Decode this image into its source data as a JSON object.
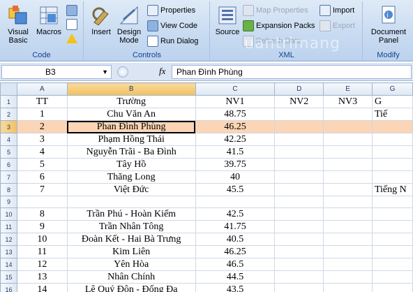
{
  "ribbon": {
    "groups": {
      "code": {
        "label": "Code",
        "visual_basic": "Visual\nBasic",
        "macros": "Macros"
      },
      "controls": {
        "label": "Controls",
        "insert": "Insert",
        "design_mode": "Design\nMode",
        "properties": "Properties",
        "view_code": "View Code",
        "run_dialog": "Run Dialog"
      },
      "xml": {
        "label": "XML",
        "source": "Source",
        "map_properties": "Map Properties",
        "expansion_packs": "Expansion Packs",
        "refresh_data": "Refresh Data",
        "import": "Import",
        "export": "Export"
      },
      "modify": {
        "label": "Modify",
        "document_panel": "Document\nPanel"
      }
    },
    "watermark": "uantrimang"
  },
  "formula_bar": {
    "name_box": "B3",
    "fx": "fx",
    "formula": "Phan Đình Phùng"
  },
  "grid": {
    "columns": [
      "A",
      "B",
      "C",
      "D",
      "E",
      "G"
    ],
    "selected_col": "B",
    "rows": [
      {
        "n": "1",
        "a": "TT",
        "b": "Trường",
        "c": "NV1",
        "d": "NV2",
        "e": "NV3",
        "g": "G"
      },
      {
        "n": "2",
        "a": "1",
        "b": "Chu Văn An",
        "c": "48.75",
        "d": "",
        "e": "",
        "g": "Tiế"
      },
      {
        "n": "3",
        "a": "2",
        "b": "Phan Đình Phùng",
        "c": "46.25",
        "d": "",
        "e": "",
        "g": ""
      },
      {
        "n": "4",
        "a": "3",
        "b": "Phạm Hồng Thái",
        "c": "42.25",
        "d": "",
        "e": "",
        "g": ""
      },
      {
        "n": "5",
        "a": "4",
        "b": "Nguyễn Trãi - Ba Đình",
        "c": "41.5",
        "d": "",
        "e": "",
        "g": ""
      },
      {
        "n": "6",
        "a": "5",
        "b": "Tây Hồ",
        "c": "39.75",
        "d": "",
        "e": "",
        "g": ""
      },
      {
        "n": "7",
        "a": "6",
        "b": "Thăng Long",
        "c": "40",
        "d": "",
        "e": "",
        "g": ""
      },
      {
        "n": "8",
        "a": "7",
        "b": "Việt Đức",
        "c": "45.5",
        "d": "",
        "e": "",
        "g": "Tiếng N"
      },
      {
        "n": "9",
        "a": "",
        "b": "",
        "c": "",
        "d": "",
        "e": "",
        "g": ""
      },
      {
        "n": "10",
        "a": "8",
        "b": "Trần Phú - Hoàn Kiếm",
        "c": "42.5",
        "d": "",
        "e": "",
        "g": ""
      },
      {
        "n": "11",
        "a": "9",
        "b": "Trần Nhân Tông",
        "c": "41.75",
        "d": "",
        "e": "",
        "g": ""
      },
      {
        "n": "12",
        "a": "10",
        "b": "Đoàn Kết - Hai Bà Trưng",
        "c": "40.5",
        "d": "",
        "e": "",
        "g": ""
      },
      {
        "n": "13",
        "a": "11",
        "b": "Kim Liên",
        "c": "46.25",
        "d": "",
        "e": "",
        "g": ""
      },
      {
        "n": "14",
        "a": "12",
        "b": "Yên Hòa",
        "c": "46.5",
        "d": "",
        "e": "",
        "g": ""
      },
      {
        "n": "15",
        "a": "13",
        "b": "Nhân Chính",
        "c": "44.5",
        "d": "",
        "e": "",
        "g": ""
      },
      {
        "n": "16",
        "a": "14",
        "b": "Lê Quý Đôn - Đống Đa",
        "c": "43.5",
        "d": "",
        "e": "",
        "g": ""
      }
    ]
  }
}
